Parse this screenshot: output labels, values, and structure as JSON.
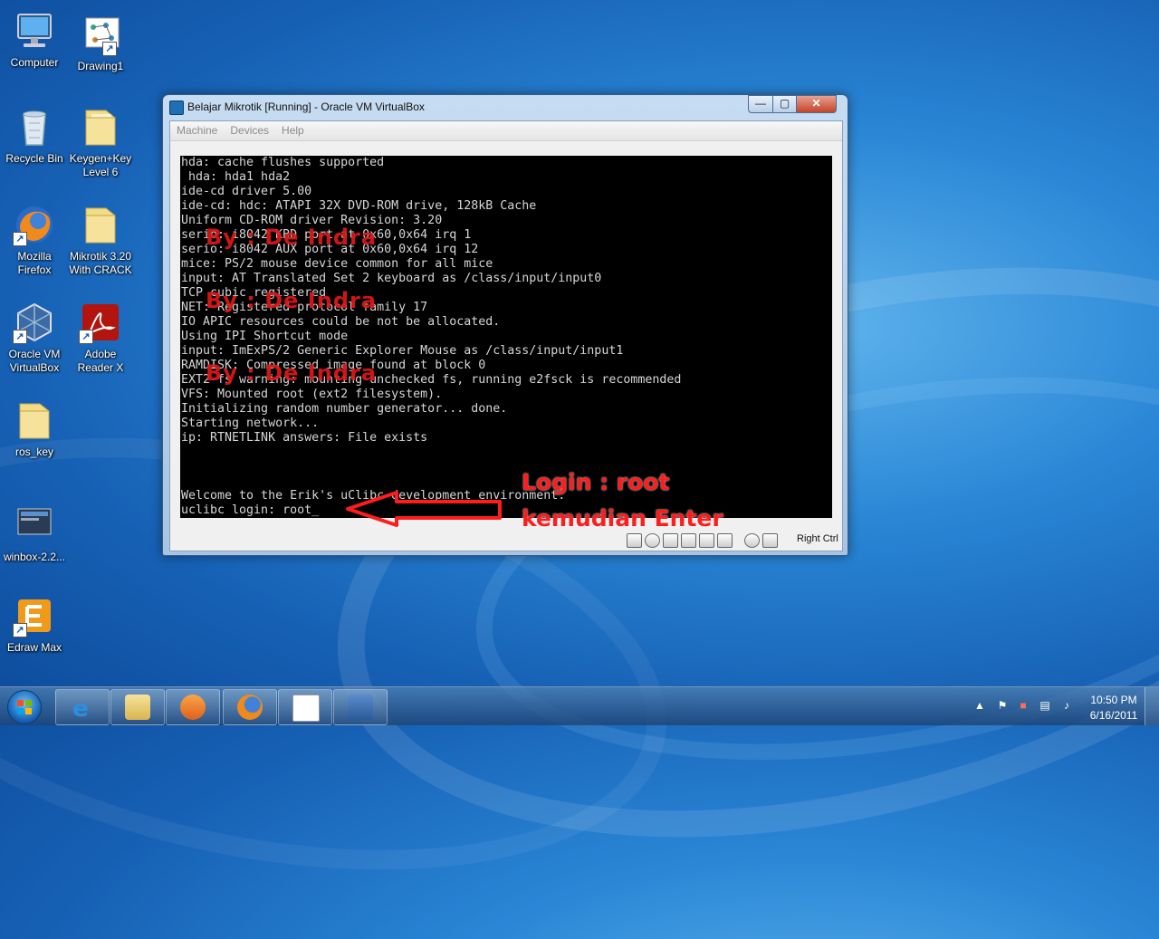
{
  "desktop": {
    "icons": [
      {
        "label": "Computer"
      },
      {
        "label": "Drawing1"
      },
      {
        "label": "Recycle Bin"
      },
      {
        "label": "Keygen+Key Level 6"
      },
      {
        "label": "Mozilla Firefox"
      },
      {
        "label": "Mikrotik 3.20 With CRACK"
      },
      {
        "label": "Oracle VM VirtualBox"
      },
      {
        "label": "Adobe Reader X"
      },
      {
        "label": "ros_key"
      },
      {
        "label": "winbox-2.2..."
      },
      {
        "label": "Edraw Max"
      }
    ]
  },
  "window": {
    "title": "Belajar Mikrotik [Running] - Oracle VM VirtualBox",
    "controls": {
      "minimize": "—",
      "maximize": "▢",
      "close": "✕"
    },
    "menu": [
      "Machine",
      "Devices",
      "Help"
    ],
    "console_lines": [
      "hda: cache flushes supported",
      " hda: hda1 hda2",
      "ide-cd driver 5.00",
      "ide-cd: hdc: ATAPI 32X DVD-ROM drive, 128kB Cache",
      "Uniform CD-ROM driver Revision: 3.20",
      "serio: i8042 KBD port at 0x60,0x64 irq 1",
      "serio: i8042 AUX port at 0x60,0x64 irq 12",
      "mice: PS/2 mouse device common for all mice",
      "input: AT Translated Set 2 keyboard as /class/input/input0",
      "TCP cubic registered",
      "NET: Registered protocol family 17",
      "IO APIC resources could be not be allocated.",
      "Using IPI Shortcut mode",
      "input: ImExPS/2 Generic Explorer Mouse as /class/input/input1",
      "RAMDISK: Compressed image found at block 0",
      "EXT2-fs warning: mounting unchecked fs, running e2fsck is recommended",
      "VFS: Mounted root (ext2 filesystem).",
      "Initializing random number generator... done.",
      "Starting network...",
      "ip: RTNETLINK answers: File exists",
      "",
      "",
      "",
      "Welcome to the Erik's uClibc development environment.",
      "uclibc login: root_"
    ],
    "watermark": "By : De Indra",
    "host_key": "Right Ctrl"
  },
  "annotation": {
    "line1": "Login : root",
    "line2": "kemudian Enter",
    "color": "#ff1c1c"
  },
  "taskbar": {
    "apps": [
      "internet-explorer",
      "windows-explorer",
      "media-player",
      "firefox",
      "document-app",
      "virtualbox"
    ],
    "clock_time": "10:50 PM",
    "clock_date": "6/16/2011"
  }
}
